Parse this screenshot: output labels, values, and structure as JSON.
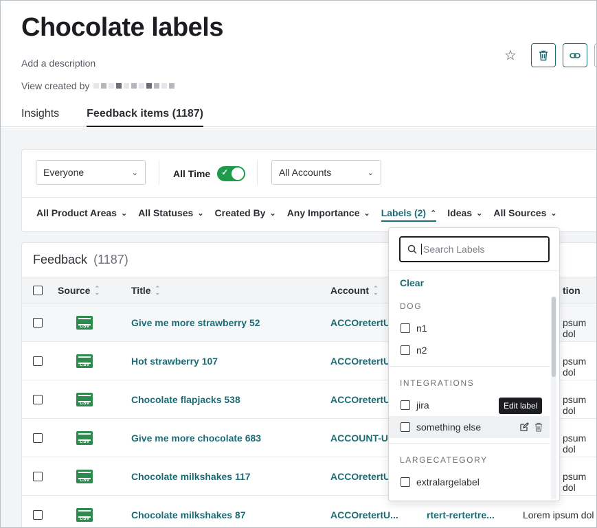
{
  "header": {
    "title": "Chocolate labels",
    "description": "Add a description",
    "created_by_label": "View created by",
    "actions": {
      "star_icon": "star-icon",
      "delete_icon": "trash-icon",
      "link_icon": "link-icon"
    }
  },
  "tabs": [
    {
      "label": "Insights"
    },
    {
      "label": "Feedback items  (1187)"
    }
  ],
  "filters": {
    "people_select": "Everyone",
    "time_label": "All Time",
    "accounts_select": "All Accounts",
    "row": [
      {
        "label": "All Product Areas"
      },
      {
        "label": "All Statuses"
      },
      {
        "label": "Created By"
      },
      {
        "label": "Any Importance"
      },
      {
        "label": "Labels (2)"
      },
      {
        "label": "Ideas"
      },
      {
        "label": "All Sources"
      }
    ]
  },
  "feedback": {
    "title": "Feedback",
    "count": "(1187)",
    "columns": {
      "source": "Source",
      "title": "Title",
      "account": "Account",
      "description": "tion"
    },
    "rows": [
      {
        "title": "Give me more strawberry 52",
        "account": "ACCOretertU",
        "desc": "psum dol"
      },
      {
        "title": "Hot strawberry 107",
        "account": "ACCOretertU",
        "desc": "psum dol"
      },
      {
        "title": "Chocolate flapjacks 538",
        "account": "ACCOretertU",
        "desc": "psum dol"
      },
      {
        "title": "Give me more chocolate 683",
        "account": "ACCOUNT-U",
        "desc": "psum dol"
      },
      {
        "title": "Chocolate milkshakes 117",
        "account": "ACCOretertU",
        "desc": "psum dol"
      },
      {
        "title": "Chocolate milkshakes 87",
        "account": "ACCOretertU...",
        "account2": "rtert-rertertre...",
        "desc": "Lorem ipsum dol"
      }
    ]
  },
  "labels_dropdown": {
    "search_placeholder": "Search Labels",
    "clear": "Clear",
    "categories": [
      {
        "name": "DOG",
        "options": [
          "n1",
          "n2"
        ]
      },
      {
        "name": "INTEGRATIONS",
        "options": [
          "jira",
          "something else"
        ]
      },
      {
        "name": "LARGECATEGORY",
        "options": [
          "extralargelabel"
        ]
      }
    ],
    "tooltip": "Edit label"
  },
  "colors": {
    "accent": "#1d6b74",
    "toggle": "#1e9a4b",
    "csv": "#2e8b4e"
  }
}
